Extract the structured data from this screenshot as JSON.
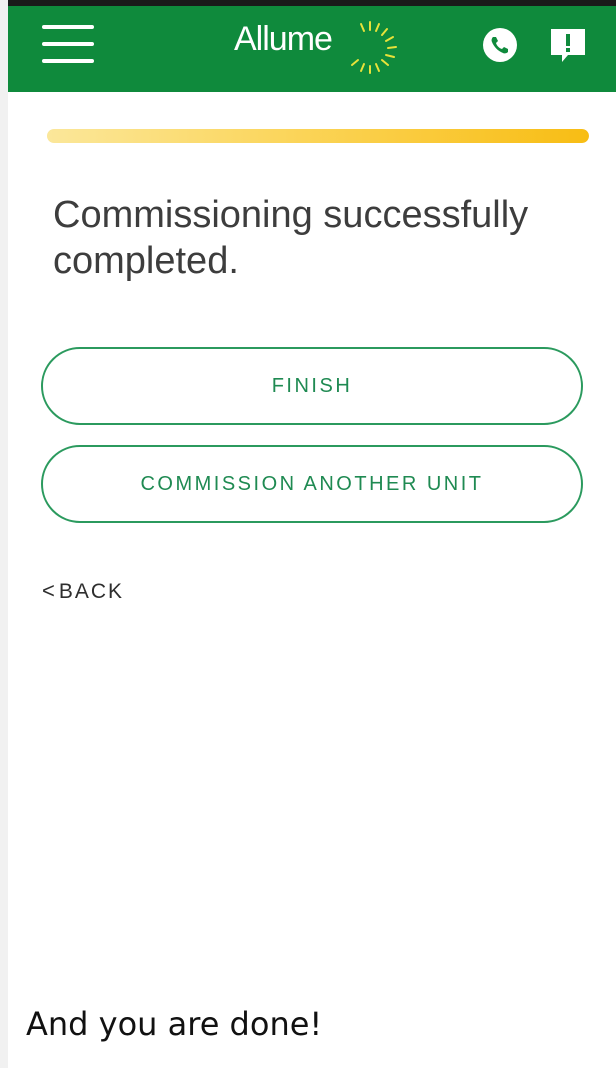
{
  "app": {
    "logo_text": "Allume",
    "brand_color": "#0f8a3c",
    "accent_color": "#f8bd14"
  },
  "header": {
    "menu_icon": "hamburger-menu-icon",
    "call_icon": "phone-icon",
    "feedback_icon": "feedback-icon"
  },
  "progress": {
    "percent": 100
  },
  "main": {
    "title": "Commissioning successfully completed.",
    "finish_label": "FINISH",
    "commission_another_label": "COMMISSION ANOTHER UNIT",
    "back_chevron": "<",
    "back_label": "BACK"
  },
  "caption": {
    "text": "And you are done!"
  }
}
